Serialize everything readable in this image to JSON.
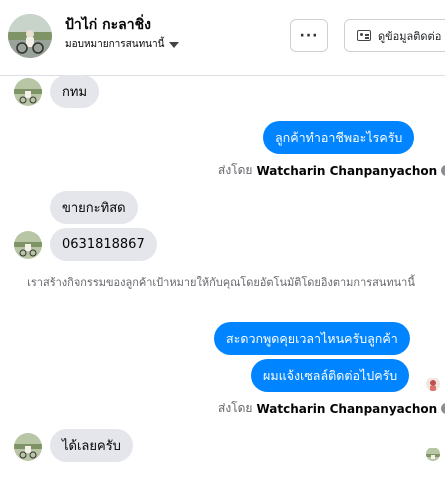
{
  "header": {
    "name": "ป้าไก่ กะลาชิ่ง",
    "assign_label": "มอบหมายการสนทนานี้",
    "more_label": "···",
    "contact_label": "ดูข้อมูลติดต่อ"
  },
  "messages": {
    "m1": "กทม",
    "m2": "ลูกค้าทำอาชีพอะไรครับ",
    "sentby1_prefix": "ส่งโดย",
    "sentby1_name": "Watcharin Chanpanyachon",
    "m3": "ขายกะทิสด",
    "m4": "0631818867",
    "system": "เราสร้างกิจกรรมของลูกค้าเป้าหมายให้กับคุณโดยอัตโนมัติโดยอิงตามการสนทนานี้",
    "m5": "สะดวกพูดคุยเวลาไหนครับลูกค้า",
    "m6": "ผมแจ้งเซลล์ติดต่อไปครับ",
    "sentby2_prefix": "ส่งโดย",
    "sentby2_name": "Watcharin Chanpanyachon",
    "m7": "ได้เลยครับ"
  },
  "icons": {
    "info": "info-icon",
    "contact": "contact-card-icon",
    "caret": "caret-down-icon"
  },
  "colors": {
    "outgoing": "#0084ff",
    "incoming": "#e4e6eb"
  }
}
